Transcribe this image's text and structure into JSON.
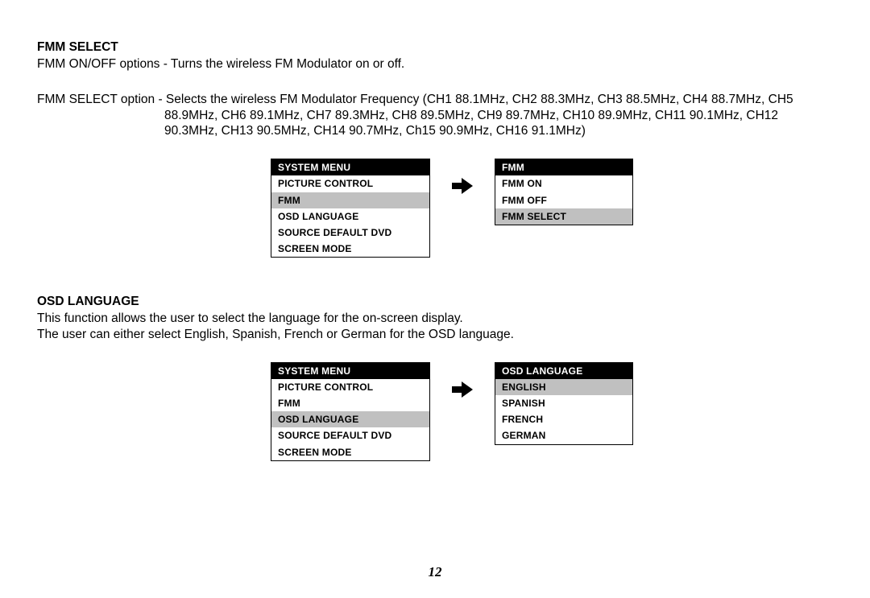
{
  "fmm": {
    "heading": "FMM SELECT",
    "line1": "FMM ON/OFF options - Turns the wireless  FM Modulator on or off.",
    "line2": "FMM SELECT option - Selects the wireless FM Modulator Frequency (CH1  88.1MHz, CH2  88.3MHz, CH3  88.5MHz, CH4  88.7MHz, CH5",
    "line3": "88.9MHz, CH6  89.1MHz, CH7  89.3MHz, CH8  89.5MHz, CH9  89.7MHz, CH10  89.9MHz, CH11  90.1MHz, CH12",
    "line4": "90.3MHz, CH13  90.5MHz, CH14  90.7MHz, Ch15  90.9MHz, CH16  91.1MHz)"
  },
  "osd": {
    "heading": "OSD LANGUAGE",
    "line1": "This function allows the user to select the language for the on-screen display.",
    "line2": "The user can either select English, Spanish, French or German for the OSD language."
  },
  "menu1_left": {
    "header": "SYSTEM MENU",
    "items": [
      "PICTURE CONTROL",
      "FMM",
      "OSD LANGUAGE",
      "SOURCE DEFAULT DVD",
      "SCREEN MODE"
    ],
    "highlight_index": 1
  },
  "menu1_right": {
    "header": "FMM",
    "items": [
      "FMM ON",
      "FMM OFF",
      "FMM SELECT"
    ],
    "highlight_index": 2
  },
  "menu2_left": {
    "header": "SYSTEM MENU",
    "items": [
      "PICTURE CONTROL",
      "FMM",
      "OSD LANGUAGE",
      "SOURCE DEFAULT DVD",
      "SCREEN MODE"
    ],
    "highlight_index": 2
  },
  "menu2_right": {
    "header": "OSD LANGUAGE",
    "items": [
      "ENGLISH",
      "SPANISH",
      "FRENCH",
      "GERMAN"
    ],
    "highlight_index": 0
  },
  "page_number": "12"
}
